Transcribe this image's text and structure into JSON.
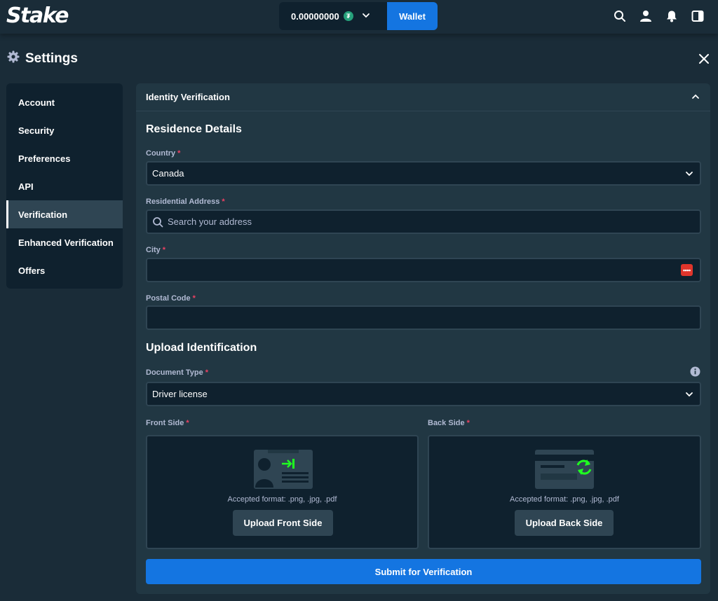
{
  "header": {
    "logo": "Stake",
    "balance": "0.00000000",
    "currency_icon": "tether-icon",
    "wallet_label": "Wallet",
    "icons": [
      "search-icon",
      "user-icon",
      "bell-icon",
      "sidebar-toggle-icon"
    ]
  },
  "settings": {
    "title": "Settings",
    "nav": [
      {
        "label": "Account"
      },
      {
        "label": "Security"
      },
      {
        "label": "Preferences"
      },
      {
        "label": "API"
      },
      {
        "label": "Verification",
        "active": true
      },
      {
        "label": "Enhanced Verification"
      },
      {
        "label": "Offers"
      }
    ]
  },
  "panel": {
    "title": "Identity Verification",
    "residence": {
      "title": "Residence Details",
      "country": {
        "label": "Country",
        "value": "Canada"
      },
      "address": {
        "label": "Residential Address",
        "placeholder": "Search your address"
      },
      "city": {
        "label": "City",
        "value": ""
      },
      "postal": {
        "label": "Postal Code",
        "value": ""
      }
    },
    "upload": {
      "title": "Upload Identification",
      "doc_type": {
        "label": "Document Type",
        "value": "Driver license"
      },
      "front": {
        "label": "Front Side",
        "accepted": "Accepted format: .png, .jpg, .pdf",
        "button": "Upload Front Side"
      },
      "back": {
        "label": "Back Side",
        "accepted": "Accepted format: .png, .jpg, .pdf",
        "button": "Upload Back Side"
      }
    },
    "submit_label": "Submit for Verification"
  },
  "colors": {
    "bg": "#1a2c38",
    "panel": "#213743",
    "input": "#0f212e",
    "border": "#2f4553",
    "accent": "#1475e1",
    "required": "#ed4163",
    "tether": "#26a17b",
    "password_manager": "#e0352b"
  }
}
